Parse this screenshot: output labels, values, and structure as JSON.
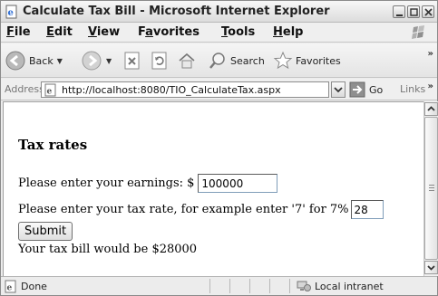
{
  "window": {
    "title": "Calculate Tax Bill - Microsoft Internet Explorer"
  },
  "menu": {
    "items": [
      {
        "underline": "F",
        "rest": "ile"
      },
      {
        "underline": "E",
        "rest": "dit"
      },
      {
        "underline": "V",
        "rest": "iew"
      },
      {
        "pre": "F",
        "underline": "a",
        "rest": "vorites"
      },
      {
        "underline": "T",
        "rest": "ools"
      },
      {
        "underline": "H",
        "rest": "elp"
      }
    ]
  },
  "toolbar": {
    "back_label": "Back",
    "search_label": "Search",
    "favorites_label": "Favorites",
    "overflow": "»"
  },
  "address": {
    "label": "Address",
    "url": "http://localhost:8080/TIO_CalculateTax.aspx",
    "go_label": "Go",
    "links_label": "Links",
    "overflow": "»"
  },
  "page": {
    "heading": "Tax rates",
    "earnings_label": "Please enter your earnings: $",
    "earnings_value": "100000",
    "rate_label": "Please enter your tax rate, for example enter '7' for 7%",
    "rate_value": "28",
    "submit_label": "Submit",
    "result_text": "Your tax bill would be $28000"
  },
  "status": {
    "text": "Done",
    "zone": "Local intranet"
  }
}
